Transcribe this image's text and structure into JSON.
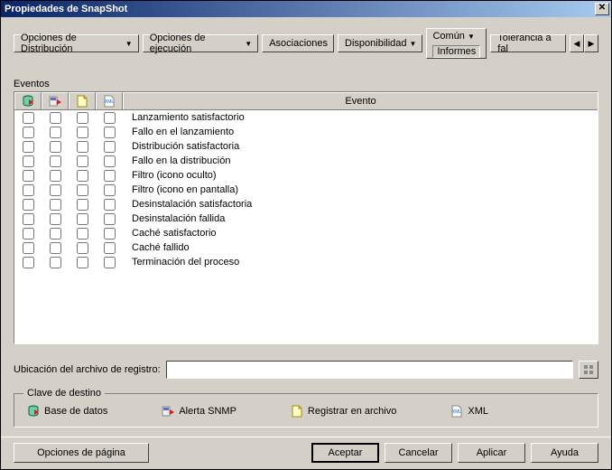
{
  "window": {
    "title": "Propiedades de SnapShot"
  },
  "tabs": {
    "items": [
      {
        "label": "Opciones de Distribución"
      },
      {
        "label": "Opciones de ejecución"
      },
      {
        "label": "Asociaciones"
      },
      {
        "label": "Disponibilidad"
      },
      {
        "label": "Común"
      },
      {
        "label": "Tolerancia a fal"
      }
    ],
    "subtab_label": "Informes"
  },
  "events_section": {
    "label": "Eventos",
    "header_event": "Evento",
    "rows": [
      {
        "name": "Lanzamiento satisfactorio"
      },
      {
        "name": "Fallo en el lanzamiento"
      },
      {
        "name": "Distribución satisfactoria"
      },
      {
        "name": "Fallo en la distribución"
      },
      {
        "name": "Filtro (icono oculto)"
      },
      {
        "name": "Filtro (icono en pantalla)"
      },
      {
        "name": "Desinstalación satisfactoria"
      },
      {
        "name": "Desinstalación fallida"
      },
      {
        "name": "Caché satisfactorio"
      },
      {
        "name": "Caché fallido"
      },
      {
        "name": "Terminación del proceso"
      }
    ]
  },
  "log_location": {
    "label": "Ubicación del archivo de registro:",
    "value": ""
  },
  "legend": {
    "title": "Clave de destino",
    "db": "Base de datos",
    "snmp": "Alerta SNMP",
    "file": "Registrar en archivo",
    "xml": "XML"
  },
  "footer": {
    "page_options": "Opciones de página",
    "ok": "Aceptar",
    "cancel": "Cancelar",
    "apply": "Aplicar",
    "help": "Ayuda"
  },
  "colors": {
    "bg": "#d4d0c8",
    "titlebar_start": "#0a246a",
    "titlebar_end": "#a6caf0"
  }
}
